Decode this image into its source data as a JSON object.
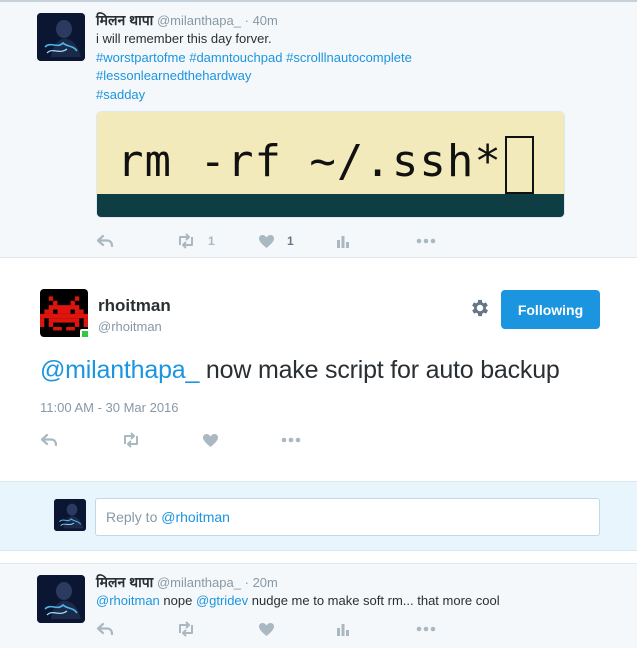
{
  "ancestor_tweet": {
    "fullname": "मिलन थापा",
    "screen_name": "@milanthapa_",
    "separator": "·",
    "time": "40m",
    "text": "i will remember this day forver.",
    "hashtags_line1": [
      "#worstpartofme",
      "#damntouchpad",
      "#scrolllnautocomplete"
    ],
    "hashtags_line2": "#lessonlearnedthehardway",
    "hashtags_line3": "#sadday",
    "media": {
      "terminal_text": "rm -rf ~/.ssh*",
      "bg_color": "#f3eabb",
      "bar_color": "#0e3e44"
    },
    "actions": {
      "retweet_count": "1",
      "like_count": "1"
    }
  },
  "main_tweet": {
    "fullname": "rhoitman",
    "screen_name": "@rhoitman",
    "follow_label": "Following",
    "mention": "@milanthapa_",
    "text": " now make script for auto backup",
    "timestamp": "11:00 AM - 30 Mar 2016",
    "accent_color": "#1b95e0"
  },
  "reply_box": {
    "prefix": "Reply to",
    "mention": "@rhoitman"
  },
  "reply_tweet": {
    "fullname": "मिलन थापा",
    "screen_name": "@milanthapa_",
    "separator": "·",
    "time": "20m",
    "mention1": "@rhoitman",
    "text1": " nope ",
    "mention2": "@gtridev",
    "text2": " nudge me to make soft rm... that more cool"
  },
  "icons": [
    "reply-icon",
    "retweet-icon",
    "heart-icon",
    "analytics-icon",
    "more-icon",
    "gear-icon"
  ]
}
